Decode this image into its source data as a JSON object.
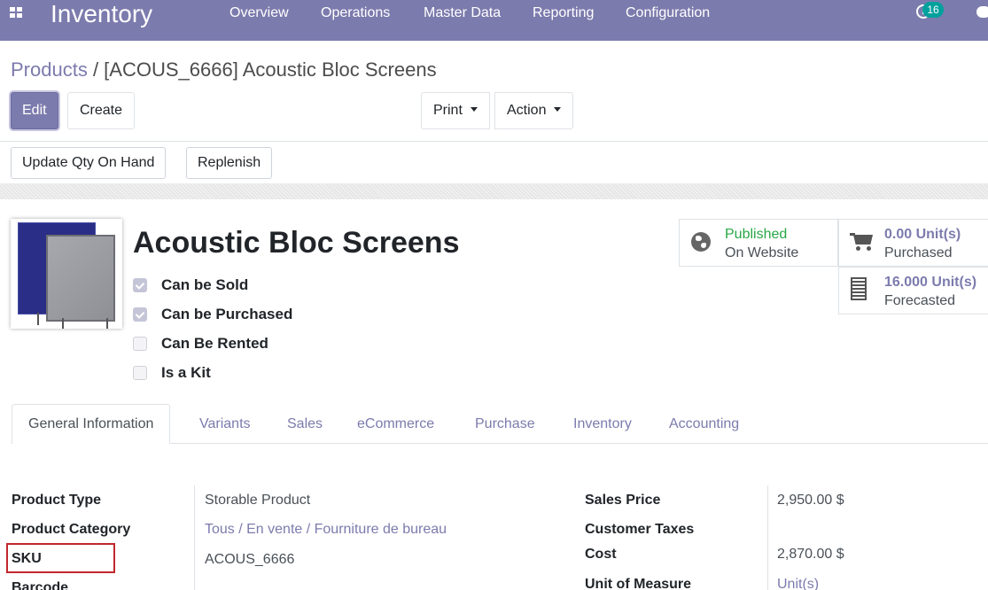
{
  "navbar": {
    "app_name": "Inventory",
    "menu": [
      "Overview",
      "Operations",
      "Master Data",
      "Reporting",
      "Configuration"
    ],
    "activity_count": "16"
  },
  "breadcrumb": {
    "parent": "Products",
    "separator": " / ",
    "current": "[ACOUS_6666] Acoustic Bloc Screens"
  },
  "buttons": {
    "edit": "Edit",
    "create": "Create",
    "print": "Print",
    "action": "Action",
    "update_qty": "Update Qty On Hand",
    "replenish": "Replenish"
  },
  "product": {
    "name": "Acoustic Bloc Screens",
    "checkboxes": [
      {
        "label": "Can be Sold",
        "checked": true
      },
      {
        "label": "Can be Purchased",
        "checked": true
      },
      {
        "label": "Can Be Rented",
        "checked": false
      },
      {
        "label": "Is a Kit",
        "checked": false
      }
    ]
  },
  "smart_buttons": {
    "website": {
      "line1": "Published",
      "line2": "On Website",
      "icon": "globe-icon",
      "color": "#28a745"
    },
    "purchased": {
      "value": "0.00 Unit(s)",
      "label": "Purchased",
      "icon": "cart-icon"
    },
    "forecasted": {
      "value": "16.000 Unit(s)",
      "label": "Forecasted",
      "icon": "building-icon"
    }
  },
  "tabs": [
    "General Information",
    "Variants",
    "Sales",
    "eCommerce",
    "Purchase",
    "Inventory",
    "Accounting"
  ],
  "fields_left": [
    {
      "label": "Product Type",
      "value": "Storable Product"
    },
    {
      "label": "Product Category",
      "value": "Tous / En vente / Fourniture de bureau"
    },
    {
      "label": "SKU",
      "value": "ACOUS_6666"
    },
    {
      "label": "Barcode",
      "value": ""
    }
  ],
  "fields_right": [
    {
      "label": "Sales Price",
      "value": "2,950.00 $"
    },
    {
      "label": "Customer Taxes",
      "value": ""
    },
    {
      "label": "Cost",
      "value": "2,870.00 $"
    },
    {
      "label": "Unit of Measure",
      "value": "Unit(s)"
    }
  ],
  "colors": {
    "brand": "#7c7bad",
    "highlight": "#c1272d",
    "published": "#28a745"
  }
}
